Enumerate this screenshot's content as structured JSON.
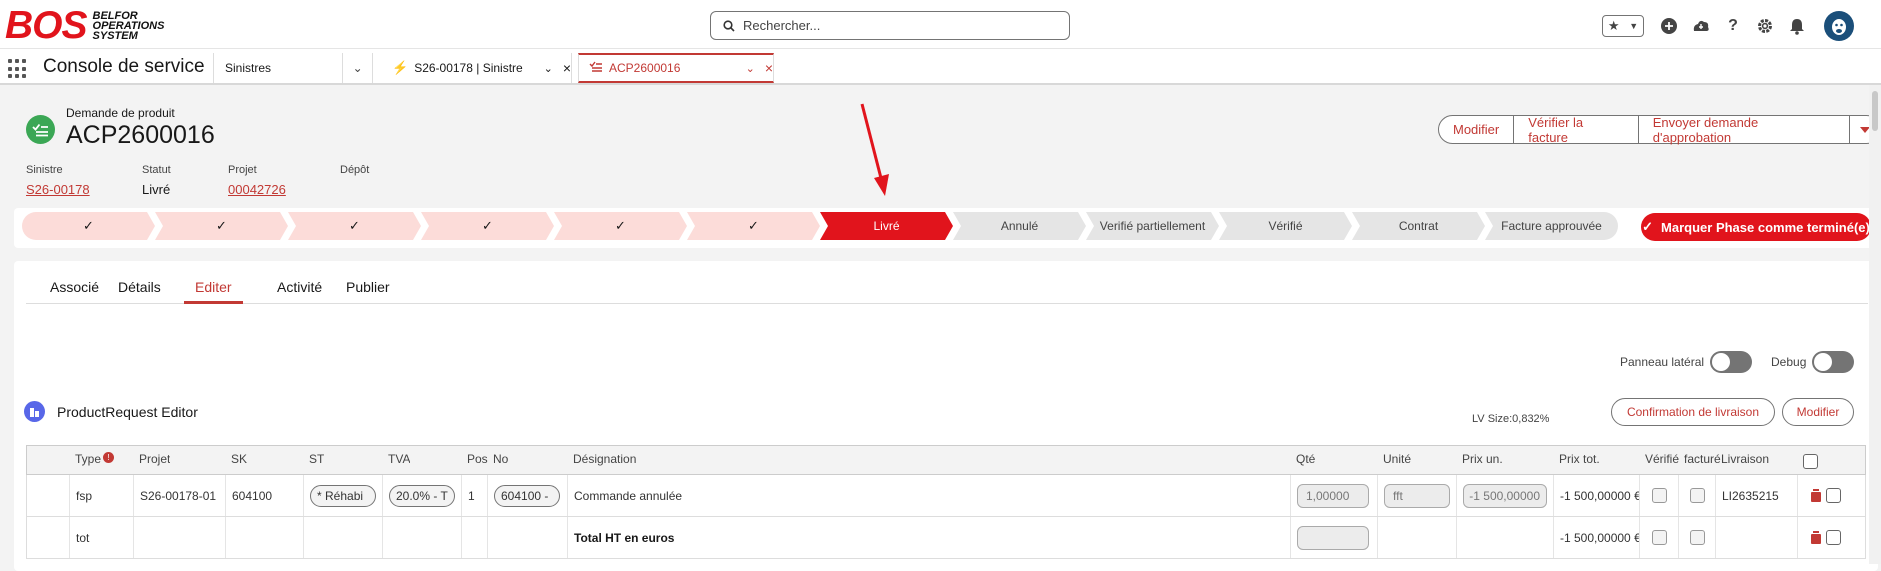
{
  "brand": {
    "mark": "BOS",
    "line1": "BELFOR",
    "line2": "OPERATIONS",
    "line3": "SYSTEM"
  },
  "search": {
    "placeholder": "Rechercher..."
  },
  "nav": {
    "app_name": "Console de service",
    "object_tab": "Sinistres",
    "tabs": [
      {
        "label": "S26-00178 | Sinistre"
      },
      {
        "label": "ACP2600016"
      }
    ]
  },
  "record": {
    "type": "Demande de produit",
    "title": "ACP2600016",
    "actions": [
      "Modifier",
      "Vérifier la facture",
      "Envoyer demande d'approbation"
    ],
    "fields": [
      {
        "label": "Sinistre",
        "value": "S26-00178"
      },
      {
        "label": "Statut",
        "value": "Livré"
      },
      {
        "label": "Projet",
        "value": "00042726"
      },
      {
        "label": "Dépôt",
        "value": ""
      }
    ]
  },
  "path": {
    "stages": [
      {
        "label": "",
        "status": "complete"
      },
      {
        "label": "",
        "status": "complete"
      },
      {
        "label": "",
        "status": "complete"
      },
      {
        "label": "",
        "status": "complete"
      },
      {
        "label": "",
        "status": "complete"
      },
      {
        "label": "",
        "status": "complete"
      },
      {
        "label": "Livré",
        "status": "current"
      },
      {
        "label": "Annulé",
        "status": "incomplete"
      },
      {
        "label": "Verifié partiellement",
        "status": "incomplete"
      },
      {
        "label": "Vérifié",
        "status": "incomplete"
      },
      {
        "label": "Contrat",
        "status": "incomplete"
      },
      {
        "label": "Facture approuvée",
        "status": "incomplete"
      }
    ],
    "mark_button": "Marquer Phase comme terminé(e)",
    "colors": {
      "complete": "#fcdcd9",
      "current": "#e1141c",
      "incomplete": "#e5e5e5"
    }
  },
  "content_tabs": [
    {
      "label": "Associé"
    },
    {
      "label": "Détails"
    },
    {
      "label": "Editer"
    },
    {
      "label": "Activité"
    },
    {
      "label": "Publier"
    }
  ],
  "toggles": {
    "side_panel": "Panneau latéral",
    "debug": "Debug"
  },
  "editor": {
    "title": "ProductRequest Editor",
    "lv_size": "LV Size:0,832%",
    "btn_confirm": "Confirmation de livraison",
    "btn_modify": "Modifier"
  },
  "table": {
    "headers": {
      "type": "Type",
      "projet": "Projet",
      "sk": "SK",
      "st": "ST",
      "tva": "TVA",
      "pos": "Pos",
      "no": "No",
      "designation": "Désignation",
      "qte": "Qté",
      "unite": "Unité",
      "prix_un": "Prix un.",
      "prix_tot": "Prix tot.",
      "verifie": "Vérifié",
      "facture": "facturé",
      "livraison": "Livraison"
    },
    "rows": [
      {
        "type": "fsp",
        "projet": "S26-00178-01",
        "sk": "604100",
        "st": "* Réhabi",
        "tva": "20.0% - T",
        "pos": "1",
        "no": "604100 -",
        "designation": "Commande annulée",
        "qte": "1,00000",
        "unite": "fft",
        "prix_un": "-1 500,00000",
        "prix_tot": "-1 500,00000 €",
        "livraison": "LI2635215"
      },
      {
        "type": "tot",
        "designation": "Total HT en euros",
        "prix_tot": "-1 500,00000 €"
      }
    ]
  }
}
